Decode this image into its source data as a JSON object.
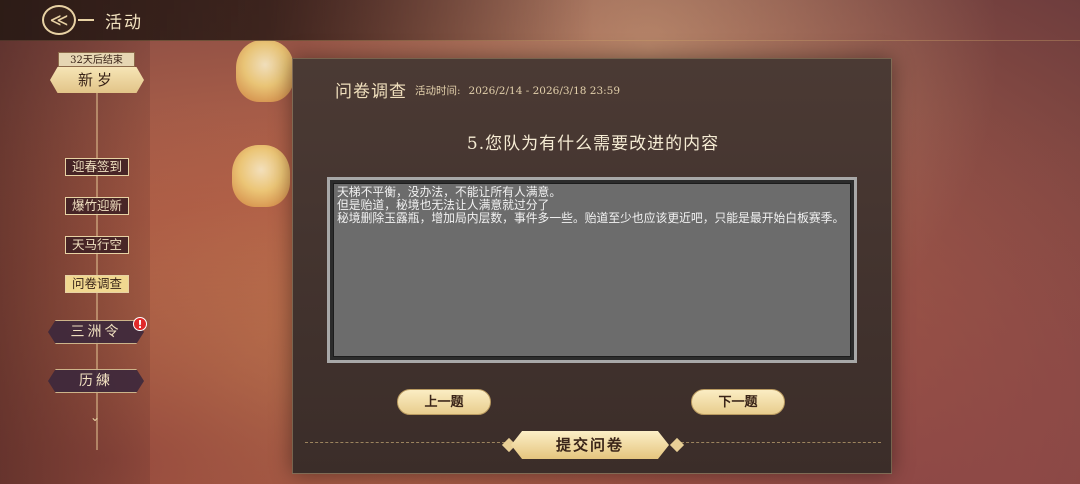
{
  "topbar": {
    "title": "活动",
    "back_icon": "back-arrow-icon"
  },
  "sidebar": {
    "countdown": "32天后结束",
    "active_tab": "新岁",
    "subitems": [
      "迎春签到",
      "爆竹迎新",
      "天马行空",
      "问卷调查"
    ],
    "selected_subitem_index": 3,
    "tabs": [
      "三洲令",
      "历練"
    ],
    "alert_badge": "!",
    "more_icon": "chevron-down-icon"
  },
  "panel": {
    "title": "问卷调查",
    "time_label": "活动时间:",
    "time_range": "2026/2/14 - 2026/3/18 23:59",
    "question": "5.您队为有什么需要改进的内容",
    "answer": "天梯不平衡，没办法，不能让所有人满意。\n但是贻道，秘境也无法让人满意就过分了\n秘境删除玉露瓶，增加局内层数，事件多一些。贻道至少也应该更近吧，只能是最开始白板赛季。",
    "prev_label": "上一题",
    "next_label": "下一题",
    "submit_label": "提交问卷"
  },
  "colors": {
    "accent": "#f1d890",
    "panel_bg": "#4b3a34",
    "alert": "#e02a2a"
  }
}
